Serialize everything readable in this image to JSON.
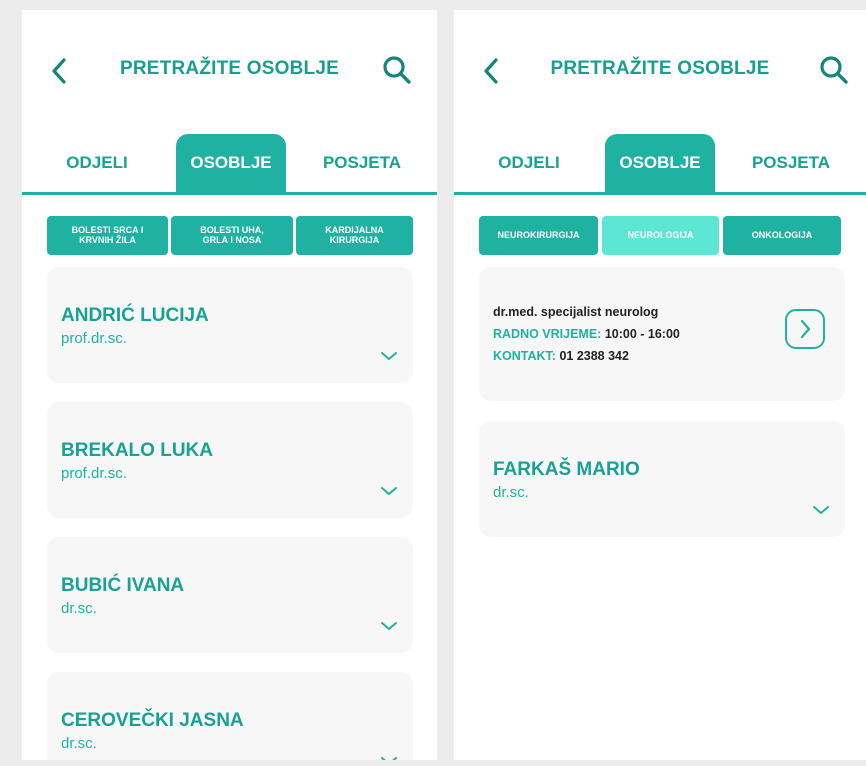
{
  "left": {
    "title": "PRETRAŽITE OSOBLJE",
    "tabs": [
      {
        "label": "ODJELI",
        "active": false
      },
      {
        "label": "OSOBLJE",
        "active": true
      },
      {
        "label": "POSJETA",
        "active": false
      }
    ],
    "chips": [
      {
        "label": "BOLESTI SRCA I\nKRVNIH ŽILA"
      },
      {
        "label": "BOLESTI UHA,\nGRLA I NOSA"
      },
      {
        "label": "KARDIJALNA\nKIRURGIJA"
      }
    ],
    "staff": [
      {
        "name": "ANDRIĆ LUCIJA",
        "title": "prof.dr.sc."
      },
      {
        "name": "BREKALO LUKA",
        "title": "prof.dr.sc."
      },
      {
        "name": "BUBIĆ IVANA",
        "title": "dr.sc."
      },
      {
        "name": "CEROVEČKI JASNA",
        "title": "dr.sc."
      }
    ]
  },
  "right": {
    "title": "PRETRAŽITE OSOBLJE",
    "tabs": [
      {
        "label": "ODJELI",
        "active": false
      },
      {
        "label": "OSOBLJE",
        "active": true
      },
      {
        "label": "POSJETA",
        "active": false
      }
    ],
    "chips": [
      {
        "label": "NEUROKIRURGIJA",
        "selected": true
      },
      {
        "label": "NEUROLOGIJA",
        "selected": false
      },
      {
        "label": "ONKOLOGIJA",
        "selected": true
      }
    ],
    "detail": {
      "specialty": "dr.med. specijalist neurolog",
      "hours_label": "RADNO VRIJEME:",
      "hours_value": "10:00 - 16:00",
      "contact_label": "KONTAKT:",
      "contact_value": "01 2388 342"
    },
    "staff": [
      {
        "name": "FARKAŠ MARIO",
        "title": "dr.sc."
      }
    ]
  },
  "colors": {
    "accent": "#1fb2a2",
    "accent_dark": "#17a293",
    "accent_light": "#5ee6d5",
    "card_bg": "#f7f7f7",
    "page_bg": "#ececec"
  },
  "icons": [
    "back-chevron-icon",
    "search-icon",
    "chevron-down-icon",
    "chevron-right-icon"
  ]
}
